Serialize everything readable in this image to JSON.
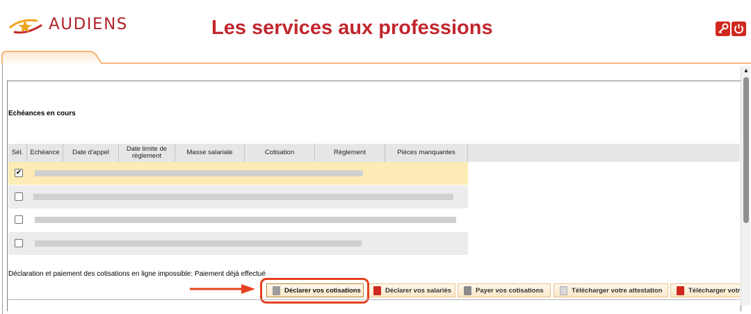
{
  "brand": {
    "name": "AUDIENS",
    "primary_color": "#c2262e",
    "accent_color": "#f2a31b"
  },
  "header": {
    "title": "Les services aux professions",
    "icons": [
      "key-icon",
      "power-icon"
    ]
  },
  "section": {
    "title": "Echéances en cours"
  },
  "table": {
    "columns": [
      "Sél.",
      "Echéance",
      "Date d'appel",
      "Date limite de règlement",
      "Masse salariale",
      "Cotisation",
      "Règlement",
      "Pièces manquantes"
    ],
    "rows": [
      {
        "selected": true,
        "checkbox_mark": "✔"
      },
      {
        "selected": false,
        "checkbox_mark": ""
      },
      {
        "selected": false,
        "checkbox_mark": ""
      },
      {
        "selected": false,
        "checkbox_mark": ""
      }
    ]
  },
  "message": "Déclaration et paiement des cotisations en ligne impossible: Paiement déjà effectué",
  "actions": {
    "declare_contributions": "Déclarer vos cotisations",
    "declare_employees": "Déclarer vos salariés",
    "pay_contributions": "Payer vos cotisations",
    "download_certificate": "Télécharger votre attestation",
    "download_other": "Télécharger votre"
  }
}
